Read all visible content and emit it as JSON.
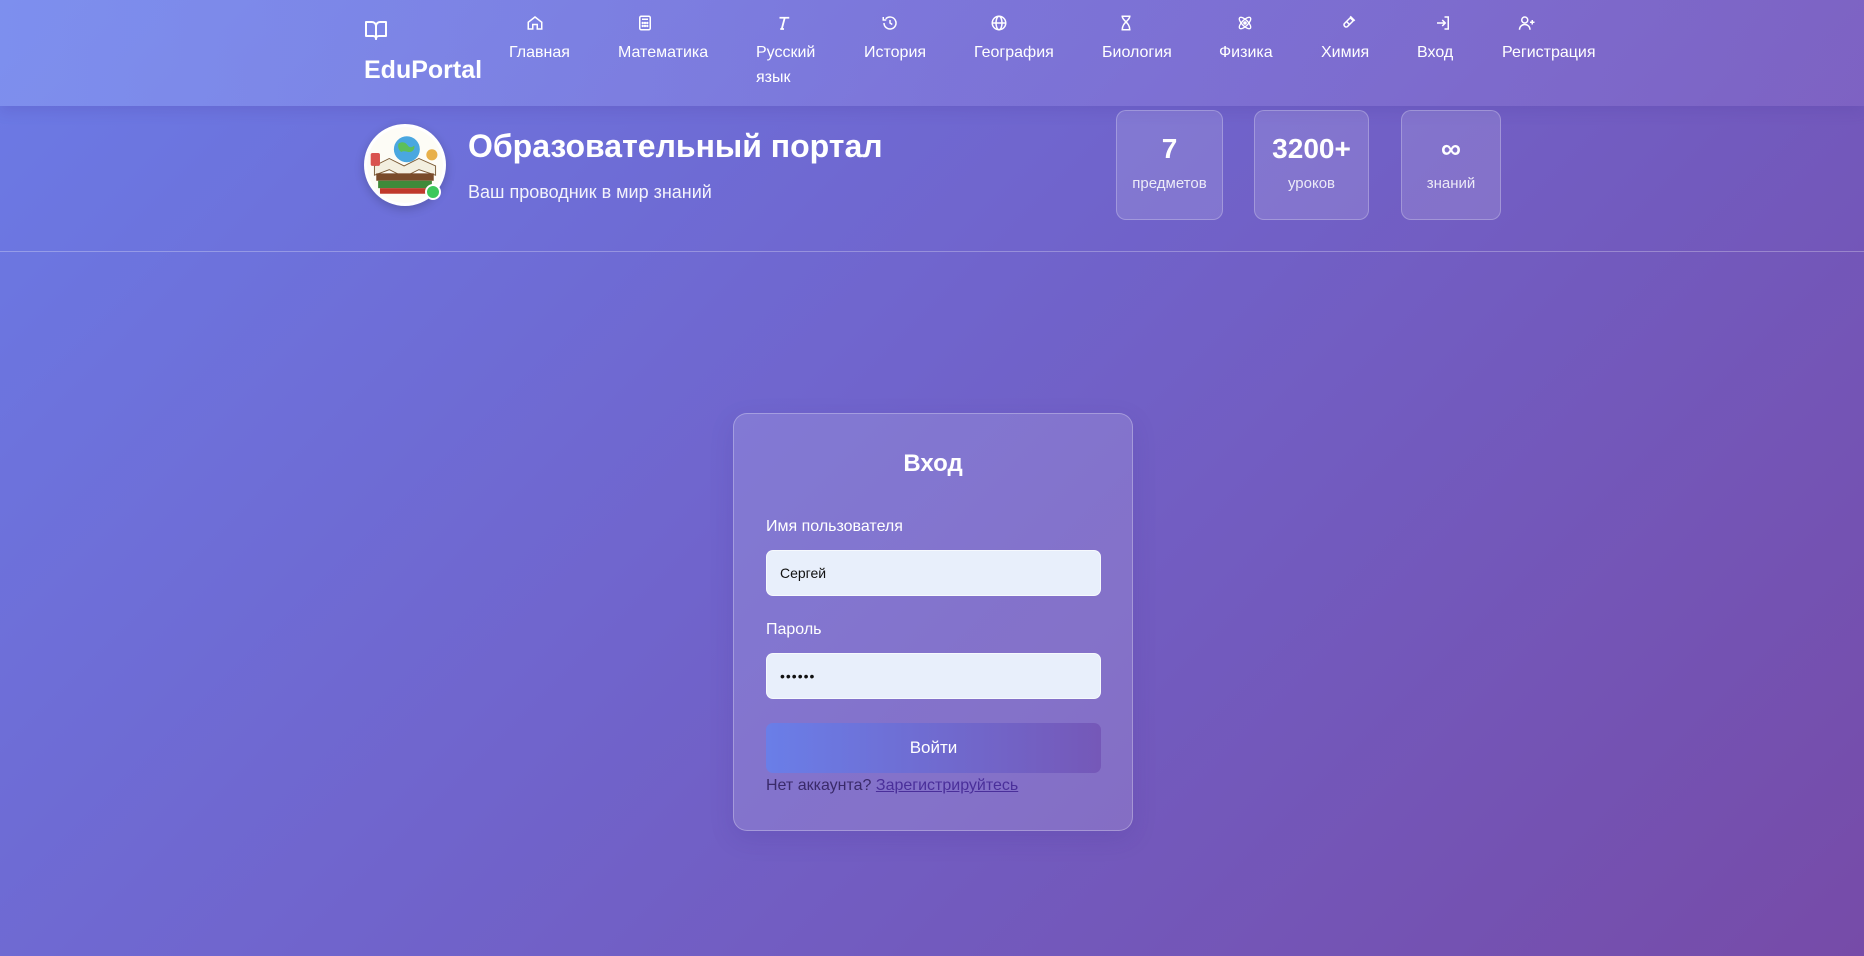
{
  "brand": {
    "name": "EduPortal",
    "icon": "book-open-icon"
  },
  "nav": [
    {
      "key": "home",
      "label": "Главная",
      "icon": "home-icon"
    },
    {
      "key": "math",
      "label": "Математика",
      "icon": "calculator-icon"
    },
    {
      "key": "russian",
      "label": "Русский язык",
      "icon": "text-icon"
    },
    {
      "key": "history",
      "label": "История",
      "icon": "history-icon"
    },
    {
      "key": "geography",
      "label": "География",
      "icon": "globe-icon"
    },
    {
      "key": "biology",
      "label": "Биология",
      "icon": "dna-icon"
    },
    {
      "key": "physics",
      "label": "Физика",
      "icon": "atom-icon"
    },
    {
      "key": "chemistry",
      "label": "Химия",
      "icon": "flask-icon"
    },
    {
      "key": "login",
      "label": "Вход",
      "icon": "sign-in-icon"
    },
    {
      "key": "register",
      "label": "Регистрация",
      "icon": "user-plus-icon"
    }
  ],
  "header": {
    "title": "Образовательный портал",
    "subtitle": "Ваш проводник в мир знаний",
    "stats": [
      {
        "value": "7",
        "caption": "предметов"
      },
      {
        "value": "3200+",
        "caption": "уроков"
      },
      {
        "value": "∞",
        "caption": "знаний"
      }
    ]
  },
  "login": {
    "title": "Вход",
    "username_label": "Имя пользователя",
    "username_value": "Сергей",
    "password_label": "Пароль",
    "password_value": "••••••",
    "submit_label": "Войти",
    "no_account_text": "Нет аккаунта?",
    "register_link": "Зарегистрируйтесь"
  },
  "colors": {
    "accent": "#6b7be6",
    "accent_dark": "#764ba8",
    "online": "#3cc85b",
    "input_bg": "#e8effb"
  }
}
